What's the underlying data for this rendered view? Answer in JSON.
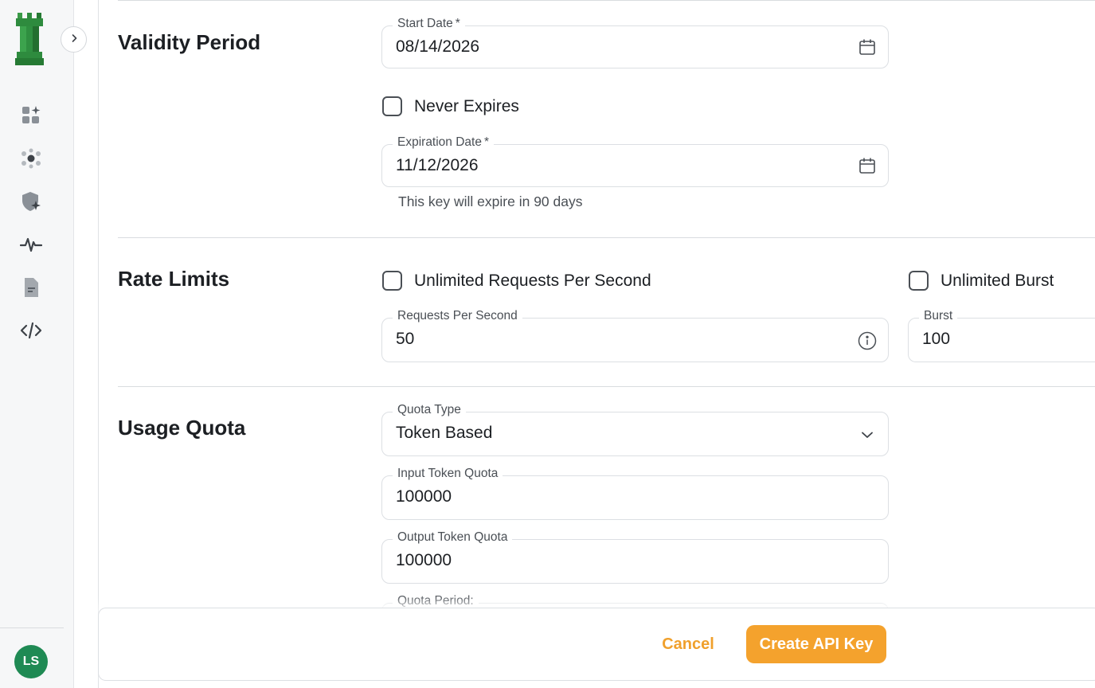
{
  "colors": {
    "accent": "#f4a22d",
    "avatar_bg": "#1f8a54",
    "logo_green": "#2e8b3e"
  },
  "sidebar": {
    "nav_items": [
      {
        "icon": "dashboard-sparkle-icon"
      },
      {
        "icon": "network-hub-icon"
      },
      {
        "icon": "shield-sparkle-icon"
      },
      {
        "icon": "activity-pulse-icon"
      },
      {
        "icon": "document-icon"
      },
      {
        "icon": "code-icon"
      }
    ],
    "user_initials": "LS"
  },
  "validity": {
    "title": "Validity Period",
    "start_date_label": "Start Date",
    "start_date_value": "08/14/2026",
    "never_expires_label": "Never Expires",
    "never_expires_checked": false,
    "expiration_label": "Expiration Date",
    "expiration_value": "11/12/2026",
    "helper": "This key will expire in 90 days",
    "required_mark": "*"
  },
  "rate_limits": {
    "title": "Rate Limits",
    "unlimited_rps_label": "Unlimited Requests Per Second",
    "unlimited_rps_checked": false,
    "unlimited_burst_label": "Unlimited Burst",
    "unlimited_burst_checked": false,
    "rps_label": "Requests Per Second",
    "rps_value": "50",
    "burst_label": "Burst",
    "burst_value": "100"
  },
  "usage_quota": {
    "title": "Usage Quota",
    "quota_type_label": "Quota Type",
    "quota_type_value": "Token Based",
    "input_quota_label": "Input Token Quota",
    "input_quota_value": "100000",
    "output_quota_label": "Output Token Quota",
    "output_quota_value": "100000",
    "period_label": "Quota Period:"
  },
  "footer": {
    "cancel_label": "Cancel",
    "create_label": "Create API Key"
  }
}
